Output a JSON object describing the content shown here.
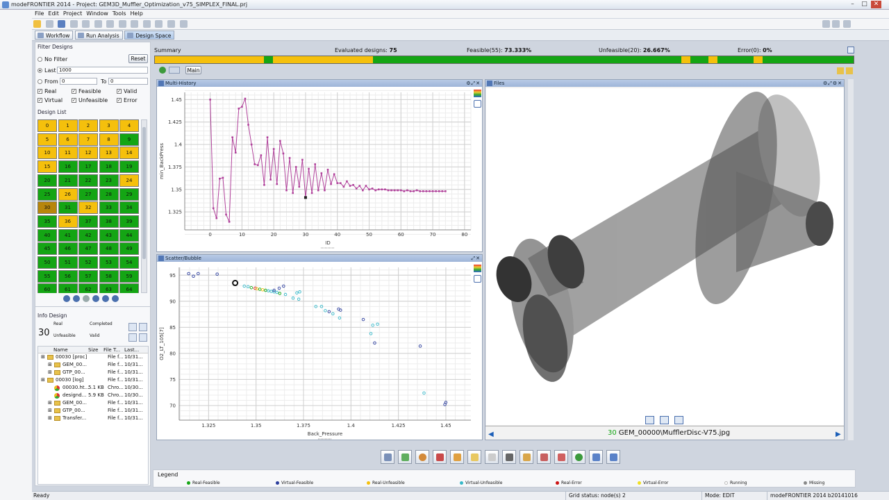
{
  "window": {
    "title": "modeFRONTIER 2014 - Project: GEM3D_Muffler_Optimization_v75_SIMPLEX_FINAL.prj"
  },
  "menu": [
    "File",
    "Edit",
    "Project",
    "Window",
    "Tools",
    "Help"
  ],
  "tabs": [
    {
      "label": "Workflow"
    },
    {
      "label": "Run Analysis"
    },
    {
      "label": "Design Space"
    }
  ],
  "filter": {
    "title": "Filter Designs",
    "no_filter": "No Filter",
    "reset": "Reset",
    "last": "Last",
    "last_value": "1000",
    "from": "From",
    "from_value": "0",
    "to": "To",
    "to_value": "0",
    "checks": [
      {
        "label": "Real"
      },
      {
        "label": "Feasible"
      },
      {
        "label": "Valid"
      },
      {
        "label": "Virtual"
      },
      {
        "label": "Unfeasible"
      },
      {
        "label": "Error"
      }
    ]
  },
  "design_list": {
    "title": "Design List",
    "cells": [
      "0",
      "1",
      "2",
      "3",
      "4",
      "5",
      "6",
      "7",
      "8",
      "9",
      "10",
      "11",
      "12",
      "13",
      "14",
      "15",
      "16",
      "17",
      "18",
      "19",
      "20",
      "21",
      "22",
      "23",
      "24",
      "25",
      "26",
      "27",
      "28",
      "29",
      "30",
      "31",
      "32",
      "33",
      "34",
      "35",
      "36",
      "37",
      "38",
      "39",
      "40",
      "41",
      "42",
      "43",
      "44",
      "45",
      "46",
      "47",
      "48",
      "49",
      "50",
      "51",
      "52",
      "53",
      "54",
      "55",
      "56",
      "57",
      "58",
      "59",
      "60",
      "61",
      "62",
      "63",
      "64"
    ],
    "status": [
      "u",
      "u",
      "u",
      "u",
      "u",
      "u",
      "u",
      "u",
      "u",
      "f",
      "u",
      "u",
      "u",
      "u",
      "u",
      "u",
      "f",
      "f",
      "f",
      "f",
      "f",
      "f",
      "f",
      "f",
      "u",
      "f",
      "u",
      "f",
      "f",
      "f",
      "s",
      "f",
      "u",
      "f",
      "f",
      "f",
      "u",
      "f",
      "f",
      "f",
      "f",
      "f",
      "f",
      "f",
      "f",
      "f",
      "f",
      "f",
      "f",
      "f",
      "f",
      "f",
      "f",
      "f",
      "f",
      "f",
      "f",
      "f",
      "f",
      "f",
      "f",
      "f",
      "f",
      "f",
      "f"
    ],
    "colors": {
      "f": "#14a514",
      "u": "#f5c00c",
      "s": "#b8860b"
    }
  },
  "info": {
    "title": "Info Design",
    "id": "30",
    "real": "Real",
    "completed": "Completed",
    "unfeasible": "Unfeasible",
    "valid": "Valid"
  },
  "tree": {
    "headers": [
      "Name",
      "Size",
      "File T...",
      "Last..."
    ],
    "rows": [
      {
        "indent": 0,
        "type": "folder",
        "name": "00030 [proc]",
        "size": "",
        "ftype": "File f...",
        "last": "10/31..."
      },
      {
        "indent": 1,
        "type": "folder",
        "name": "GEM_00...",
        "size": "",
        "ftype": "File f...",
        "last": "10/31..."
      },
      {
        "indent": 1,
        "type": "folder",
        "name": "GTP_00...",
        "size": "",
        "ftype": "File f...",
        "last": "10/31..."
      },
      {
        "indent": 0,
        "type": "folder",
        "name": "00030 [log]",
        "size": "",
        "ftype": "File f...",
        "last": "10/31..."
      },
      {
        "indent": 1,
        "type": "file",
        "name": "00030.ht...",
        "size": "5.1 KB",
        "ftype": "Chro...",
        "last": "10/30..."
      },
      {
        "indent": 1,
        "type": "file",
        "name": "designd...",
        "size": "5.9 KB",
        "ftype": "Chro...",
        "last": "10/30..."
      },
      {
        "indent": 1,
        "type": "folder",
        "name": "GEM_00...",
        "size": "",
        "ftype": "File f...",
        "last": "10/31..."
      },
      {
        "indent": 1,
        "type": "folder",
        "name": "GTP_00...",
        "size": "",
        "ftype": "File f...",
        "last": "10/31..."
      },
      {
        "indent": 1,
        "type": "folder",
        "name": "Transfer...",
        "size": "",
        "ftype": "File f...",
        "last": "10/31..."
      }
    ]
  },
  "summary": {
    "label": "Summary",
    "evaluated_label": "Evaluated designs:",
    "evaluated": "75",
    "feasible_label": "Feasible(55):",
    "feasible": "73.333%",
    "unfeasible_label": "Unfeasible(20):",
    "unfeasible": "26.667%",
    "error_label": "Error(0):",
    "error": "0%",
    "main_tab": "Main",
    "bar_status": "uuuuuuuuuuuufuuuuuuuuuuuffffffffffffffffffffffffffffffffffuffuffffuffffffffff"
  },
  "multi_history": {
    "title": "Multi-History",
    "ylabel": "min_BackPress",
    "xlabel": "ID"
  },
  "scatter": {
    "title": "Scatter/Bubble",
    "ylabel": "O2_LT_105[7]",
    "xlabel": "Back_Pressure"
  },
  "files": {
    "title": "Files",
    "file_id": "30",
    "file_name": "GEM_00000\\MufflerDisc-V75.jpg"
  },
  "legend": {
    "title": "Legend",
    "items": [
      {
        "label": "Real-Feasible",
        "color": "#14a514"
      },
      {
        "label": "Virtual-Feasible",
        "color": "#2b3d9c"
      },
      {
        "label": "Real-Unfeasible",
        "color": "#f5c00c"
      },
      {
        "label": "Virtual-Unfeasible",
        "color": "#36b7c8"
      },
      {
        "label": "Real-Error",
        "color": "#cc1111"
      },
      {
        "label": "Virtual-Error",
        "color": "#f0e020"
      },
      {
        "label": "Running",
        "color": "#ffffff"
      },
      {
        "label": "Missing",
        "color": "#888888"
      }
    ]
  },
  "status": {
    "left": "Ready",
    "grid": "Grid status: node(s) 2",
    "mode": "Mode: EDIT",
    "version": "modeFRONTIER 2014 b20141016"
  },
  "chart_data": [
    {
      "type": "line",
      "title": "Multi-History",
      "xlabel": "ID",
      "ylabel": "min_BackPress",
      "xlim": [
        -8,
        82
      ],
      "ylim": [
        1.305,
        1.458
      ],
      "xticks": [
        0,
        10,
        20,
        30,
        40,
        50,
        60,
        70,
        80
      ],
      "yticks": [
        1.325,
        1.35,
        1.375,
        1.4,
        1.425,
        1.45
      ],
      "series": [
        {
          "color": "#b0409a",
          "x": [
            0,
            1,
            2,
            3,
            4,
            5,
            6,
            7,
            8,
            9,
            10,
            11,
            12,
            13,
            14,
            15,
            16,
            17,
            18,
            19,
            20,
            21,
            22,
            23,
            24,
            25,
            26,
            27,
            28,
            29,
            30,
            31,
            32,
            33,
            34,
            35,
            36,
            37,
            38,
            39,
            40,
            41,
            42,
            43,
            44,
            45,
            46,
            47,
            48,
            49,
            50,
            51,
            52,
            53,
            54,
            55,
            56,
            57,
            58,
            59,
            60,
            61,
            62,
            63,
            64,
            65,
            66,
            67,
            68,
            69,
            70,
            71,
            72,
            73,
            74
          ],
          "values": [
            1.45,
            1.329,
            1.318,
            1.362,
            1.363,
            1.322,
            1.314,
            1.408,
            1.391,
            1.44,
            1.442,
            1.451,
            1.422,
            1.4,
            1.378,
            1.377,
            1.388,
            1.355,
            1.408,
            1.361,
            1.395,
            1.356,
            1.404,
            1.39,
            1.349,
            1.385,
            1.346,
            1.375,
            1.353,
            1.383,
            1.341,
            1.373,
            1.346,
            1.378,
            1.349,
            1.368,
            1.349,
            1.372,
            1.356,
            1.367,
            1.357,
            1.357,
            1.353,
            1.359,
            1.354,
            1.355,
            1.351,
            1.354,
            1.349,
            1.354,
            1.35,
            1.351,
            1.349,
            1.35,
            1.35,
            1.35,
            1.349,
            1.349,
            1.349,
            1.349,
            1.349,
            1.348,
            1.349,
            1.348,
            1.348,
            1.349,
            1.348,
            1.348,
            1.348,
            1.348,
            1.348,
            1.348,
            1.348,
            1.348,
            1.348
          ]
        }
      ],
      "highlight": {
        "x": 30,
        "y": 1.341
      }
    },
    {
      "type": "scatter",
      "title": "Scatter/Bubble",
      "xlabel": "Back_Pressure",
      "ylabel": "O2_LT_105[7]",
      "xlim": [
        1.3095,
        1.4632
      ],
      "ylim": [
        67.2,
        96.5
      ],
      "xticks": [
        1.325,
        1.35,
        1.375,
        1.4,
        1.425,
        1.45
      ],
      "yticks": [
        70,
        75,
        80,
        85,
        90,
        95
      ],
      "points": [
        {
          "x": 1.3145,
          "y": 95.3,
          "c": "#2b3d9c"
        },
        {
          "x": 1.317,
          "y": 94.8,
          "c": "#2b3d9c"
        },
        {
          "x": 1.3195,
          "y": 95.3,
          "c": "#2b3d9c"
        },
        {
          "x": 1.3295,
          "y": 95.2,
          "c": "#2b3d9c"
        },
        {
          "x": 1.3438,
          "y": 92.9,
          "c": "#36b7c8"
        },
        {
          "x": 1.3458,
          "y": 92.8,
          "c": "#36b7c8"
        },
        {
          "x": 1.3475,
          "y": 92.6,
          "c": "#14a514"
        },
        {
          "x": 1.3495,
          "y": 92.5,
          "c": "#cc1111"
        },
        {
          "x": 1.3505,
          "y": 92.4,
          "c": "#f5c00c"
        },
        {
          "x": 1.352,
          "y": 92.3,
          "c": "#14a514"
        },
        {
          "x": 1.3535,
          "y": 92.2,
          "c": "#f5c00c"
        },
        {
          "x": 1.355,
          "y": 92.1,
          "c": "#14a514"
        },
        {
          "x": 1.3565,
          "y": 92.0,
          "c": "#36b7c8"
        },
        {
          "x": 1.358,
          "y": 91.9,
          "c": "#36b7c8"
        },
        {
          "x": 1.3595,
          "y": 91.8,
          "c": "#36b7c8"
        },
        {
          "x": 1.361,
          "y": 91.7,
          "c": "#36b7c8"
        },
        {
          "x": 1.3625,
          "y": 91.5,
          "c": "#14a514"
        },
        {
          "x": 1.3595,
          "y": 92.1,
          "c": "#2b3d9c"
        },
        {
          "x": 1.3622,
          "y": 92.5,
          "c": "#2b3d9c"
        },
        {
          "x": 1.3645,
          "y": 92.9,
          "c": "#2b3d9c"
        },
        {
          "x": 1.3655,
          "y": 91.3,
          "c": "#36b7c8"
        },
        {
          "x": 1.3695,
          "y": 90.6,
          "c": "#36b7c8"
        },
        {
          "x": 1.3725,
          "y": 90.4,
          "c": "#36b7c8"
        },
        {
          "x": 1.3715,
          "y": 91.6,
          "c": "#36b7c8"
        },
        {
          "x": 1.373,
          "y": 91.8,
          "c": "#36b7c8"
        },
        {
          "x": 1.3815,
          "y": 89.0,
          "c": "#36b7c8"
        },
        {
          "x": 1.3845,
          "y": 89.0,
          "c": "#36b7c8"
        },
        {
          "x": 1.3865,
          "y": 88.2,
          "c": "#36b7c8"
        },
        {
          "x": 1.3885,
          "y": 88.0,
          "c": "#2b3d9c"
        },
        {
          "x": 1.3905,
          "y": 87.6,
          "c": "#36b7c8"
        },
        {
          "x": 1.394,
          "y": 86.8,
          "c": "#36b7c8"
        },
        {
          "x": 1.3935,
          "y": 88.5,
          "c": "#2b3d9c"
        },
        {
          "x": 1.3945,
          "y": 88.3,
          "c": "#2b3d9c"
        },
        {
          "x": 1.4065,
          "y": 86.5,
          "c": "#2b3d9c"
        },
        {
          "x": 1.4115,
          "y": 85.4,
          "c": "#36b7c8"
        },
        {
          "x": 1.414,
          "y": 85.6,
          "c": "#36b7c8"
        },
        {
          "x": 1.4105,
          "y": 83.8,
          "c": "#36b7c8"
        },
        {
          "x": 1.4125,
          "y": 82.0,
          "c": "#2b3d9c"
        },
        {
          "x": 1.4365,
          "y": 81.4,
          "c": "#2b3d9c"
        },
        {
          "x": 1.4385,
          "y": 72.4,
          "c": "#36b7c8"
        },
        {
          "x": 1.45,
          "y": 70.6,
          "c": "#2b3d9c"
        },
        {
          "x": 1.4495,
          "y": 70.2,
          "c": "#2b3d9c"
        }
      ],
      "highlight": {
        "x": 1.339,
        "y": 93.5
      }
    }
  ]
}
